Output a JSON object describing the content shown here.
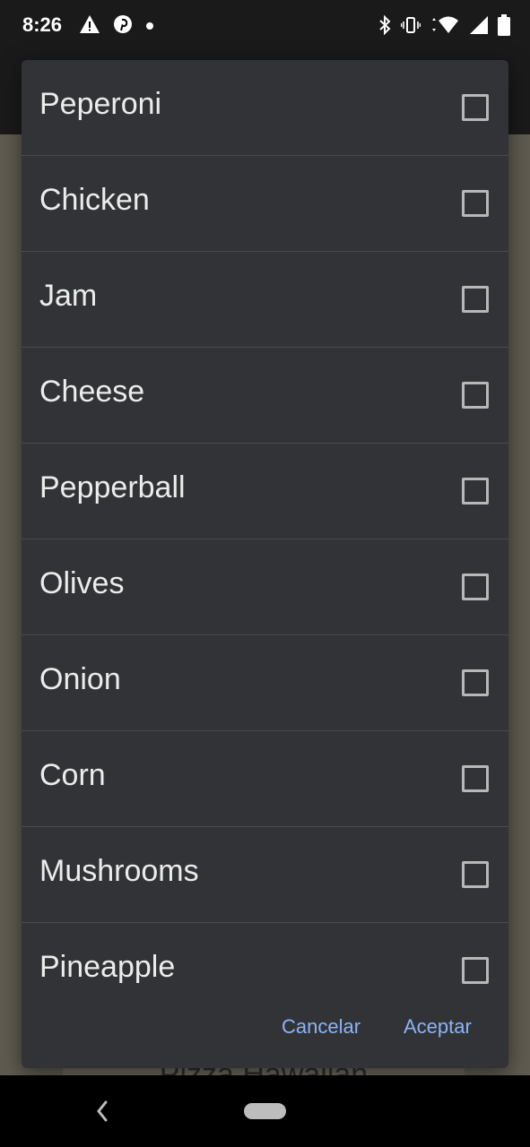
{
  "status_bar": {
    "time": "8:26",
    "left_icons": [
      "warning-icon",
      "pinterest-icon",
      "dot-icon"
    ],
    "right_icons": [
      "bluetooth-icon",
      "vibrate-icon",
      "wifi-icon",
      "signal-icon",
      "battery-icon"
    ]
  },
  "background": {
    "card_title": "Pizza Hawaiian"
  },
  "dialog": {
    "options": [
      {
        "label": "Peperoni",
        "checked": false
      },
      {
        "label": "Chicken",
        "checked": false
      },
      {
        "label": "Jam",
        "checked": false
      },
      {
        "label": "Cheese",
        "checked": false
      },
      {
        "label": "Pepperball",
        "checked": false
      },
      {
        "label": "Olives",
        "checked": false
      },
      {
        "label": "Onion",
        "checked": false
      },
      {
        "label": "Corn",
        "checked": false
      },
      {
        "label": "Mushrooms",
        "checked": false
      },
      {
        "label": "Pineapple",
        "checked": false
      }
    ],
    "cancel_label": "Cancelar",
    "accept_label": "Aceptar",
    "accent_color": "#8ab4f8"
  },
  "nav_bar": {
    "icons": [
      "back-icon",
      "home-pill-icon"
    ]
  }
}
